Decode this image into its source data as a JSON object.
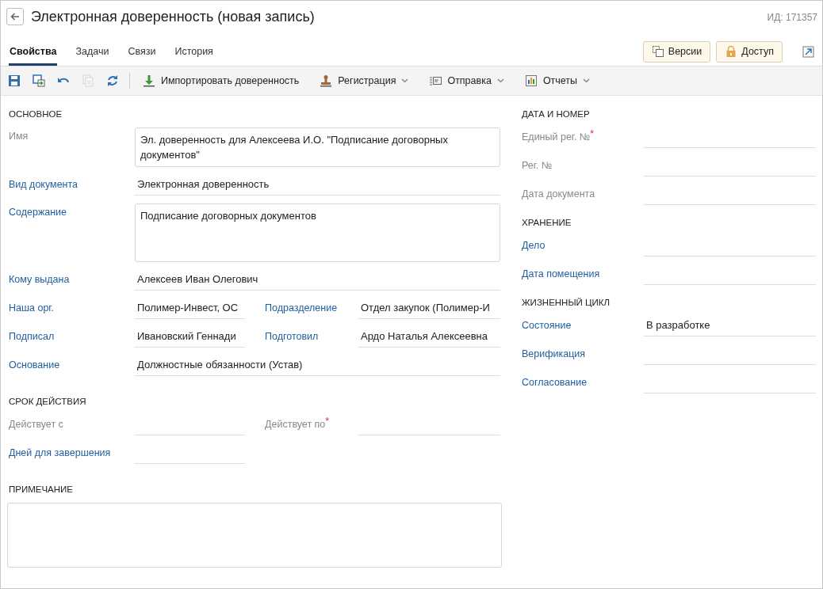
{
  "header": {
    "title": "Электронная доверенность (новая запись)",
    "id_label": "ИД: 171357"
  },
  "tabs": [
    {
      "label": "Свойства",
      "selected": true
    },
    {
      "label": "Задачи",
      "selected": false
    },
    {
      "label": "Связи",
      "selected": false
    },
    {
      "label": "История",
      "selected": false
    }
  ],
  "header_buttons": [
    {
      "kind": "versions",
      "label": "Версии"
    },
    {
      "kind": "access",
      "label": "Доступ"
    }
  ],
  "toolbar": {
    "icon_buttons": [
      {
        "kind": "save",
        "disabled": false
      },
      {
        "kind": "save-as",
        "disabled": false
      },
      {
        "kind": "undo",
        "disabled": false
      },
      {
        "kind": "copy",
        "disabled": true
      },
      {
        "kind": "refresh",
        "disabled": false
      }
    ],
    "menu_buttons": [
      {
        "kind": "import",
        "label": "Импортировать доверенность",
        "dropdown": false
      },
      {
        "kind": "stamp",
        "label": "Регистрация",
        "dropdown": true
      },
      {
        "kind": "send",
        "label": "Отправка",
        "dropdown": true
      },
      {
        "kind": "reports",
        "label": "Отчеты",
        "dropdown": true
      }
    ]
  },
  "left_sections": [
    {
      "heading": "ОСНОВНОЕ",
      "fields": [
        {
          "kind": "box",
          "label": "Имя",
          "linked": false,
          "value": "Эл. доверенность для Алексеева И.О. \"Подписание договорных документов\""
        },
        {
          "kind": "line",
          "label": "Вид документа",
          "linked": true,
          "value": "Электронная доверенность"
        },
        {
          "kind": "memo",
          "label": "Содержание",
          "linked": true,
          "value": "Подписание договорных документов"
        },
        {
          "kind": "line",
          "label": "Кому выдана",
          "linked": true,
          "value": "Алексеев Иван Олегович"
        },
        {
          "kind": "pair",
          "items": [
            {
              "label": "Наша орг.",
              "linked": true,
              "value": "Полимер-Инвест, ОС"
            },
            {
              "label": "Подразделение",
              "linked": true,
              "value": "Отдел закупок (Полимер-И"
            }
          ]
        },
        {
          "kind": "pair",
          "items": [
            {
              "label": "Подписал",
              "linked": true,
              "value": "Ивановский Геннади"
            },
            {
              "label": "Подготовил",
              "linked": true,
              "value": "Ардо Наталья Алексеевна"
            }
          ]
        },
        {
          "kind": "line",
          "label": "Основание",
          "linked": true,
          "value": "Должностные обязанности (Устав)"
        }
      ]
    },
    {
      "heading": "СРОК ДЕЙСТВИЯ",
      "fields": [
        {
          "kind": "pair",
          "items": [
            {
              "label": "Действует с",
              "linked": false
            },
            {
              "label": "Действует по",
              "linked": false,
              "required_mark": "*"
            }
          ]
        },
        {
          "kind": "short",
          "label": "Дней для завершения",
          "linked": true
        }
      ]
    }
  ],
  "note": {
    "heading": "ПРИМЕЧАНИЕ"
  },
  "right_sections": [
    {
      "heading": "ДАТА И НОМЕР",
      "fields": [
        {
          "kind": "line",
          "label": "Единый рег. №",
          "linked": false,
          "required_mark": "*"
        },
        {
          "kind": "line",
          "label": "Рег. №",
          "linked": false
        },
        {
          "kind": "line",
          "label": "Дата документа",
          "linked": false
        }
      ]
    },
    {
      "heading": "ХРАНЕНИЕ",
      "fields": [
        {
          "kind": "line",
          "label": "Дело",
          "linked": true
        },
        {
          "kind": "line",
          "label": "Дата помещения",
          "linked": true
        }
      ]
    },
    {
      "heading": "ЖИЗНЕННЫЙ ЦИКЛ",
      "fields": [
        {
          "kind": "line",
          "label": "Состояние",
          "linked": true,
          "value": "В разработке"
        },
        {
          "kind": "line",
          "label": "Верификация",
          "linked": true
        },
        {
          "kind": "line",
          "label": "Согласование",
          "linked": true
        }
      ]
    }
  ]
}
